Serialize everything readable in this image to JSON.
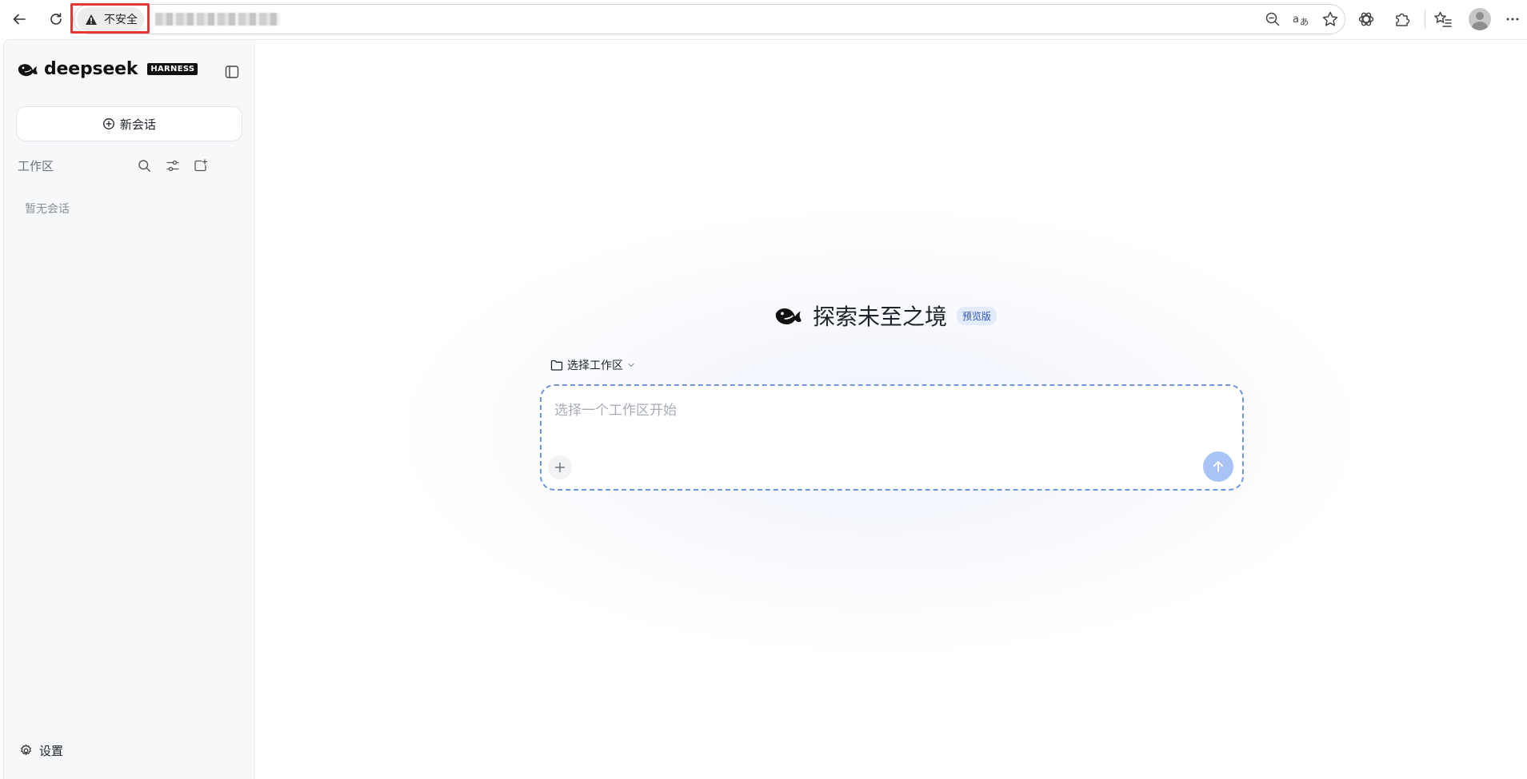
{
  "browser": {
    "security_label": "不安全",
    "url": "██████ ███ ████"
  },
  "sidebar": {
    "brand_name": "deepseek",
    "brand_badge": "HARNESS",
    "new_chat_label": "新会话",
    "workspace_section_label": "工作区",
    "empty_text": "暂无会话",
    "settings_label": "设置"
  },
  "main": {
    "hero_title": "探索未至之境",
    "preview_badge": "预览版",
    "workspace_select_label": "选择工作区",
    "composer_placeholder": "选择一个工作区开始"
  },
  "colors": {
    "accent": "#4d6bfe",
    "send_disabled": "#a9c3f7",
    "security_highlight": "#e53935"
  }
}
